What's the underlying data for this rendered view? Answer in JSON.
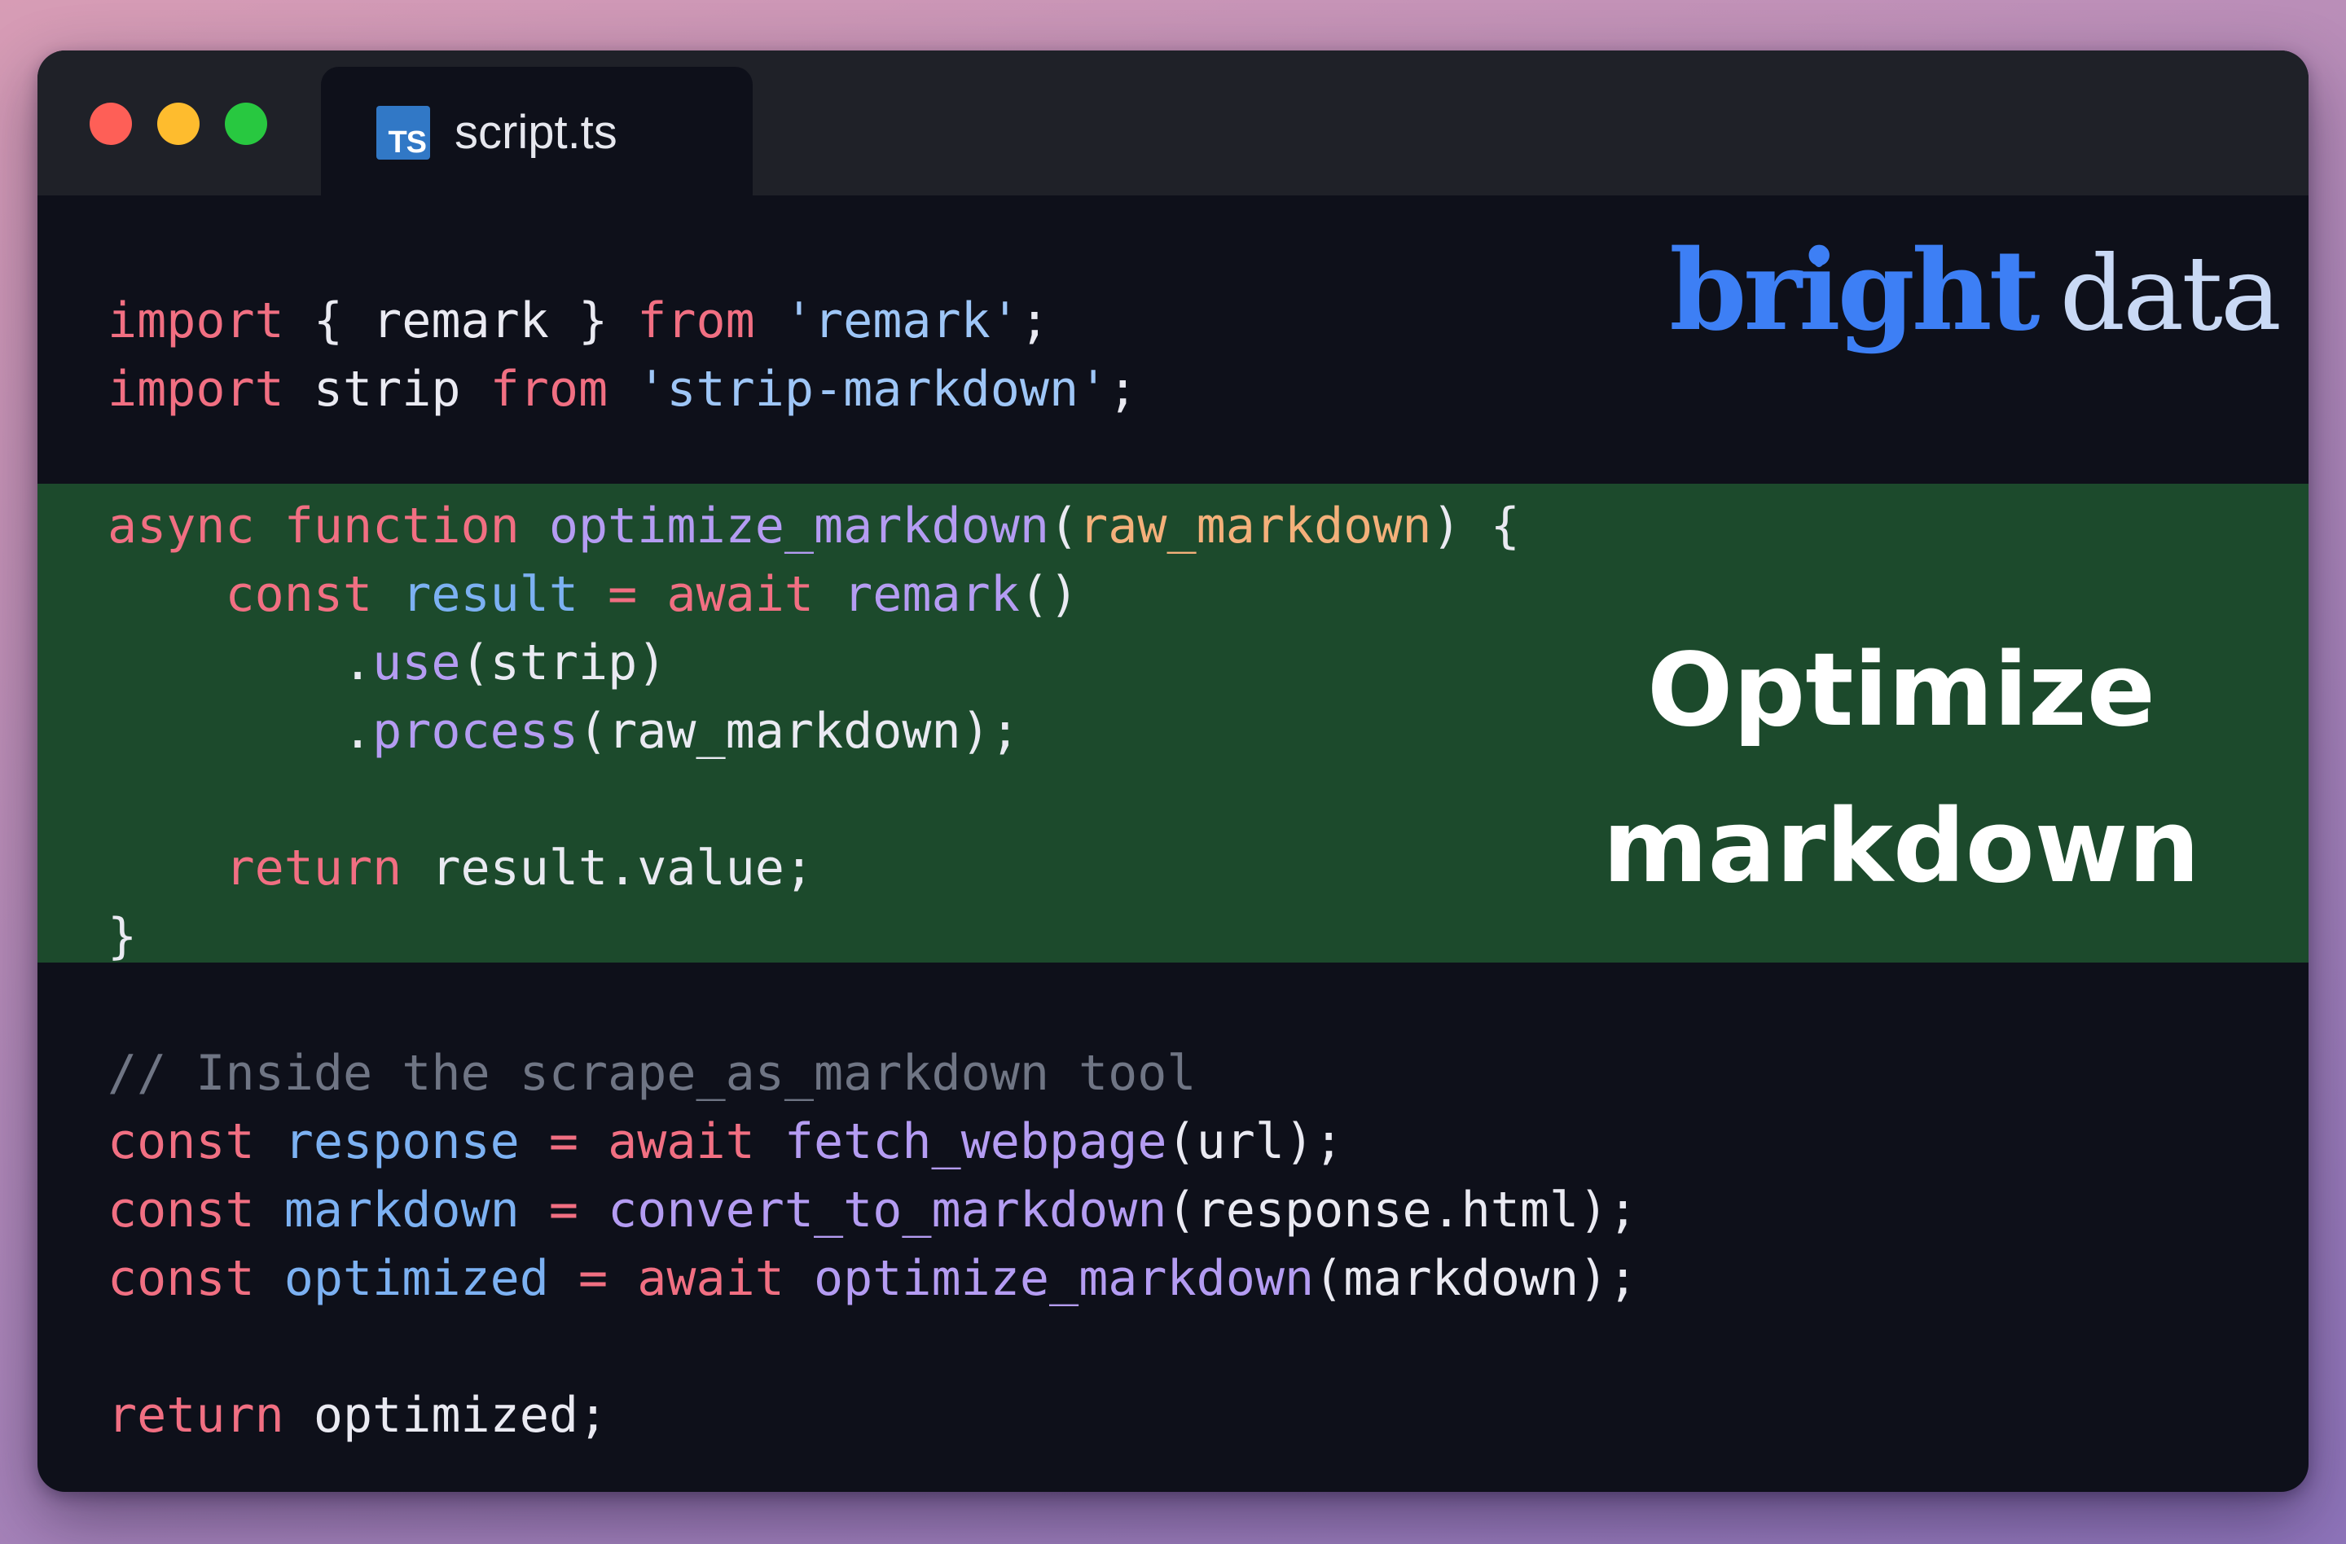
{
  "window": {
    "tab": {
      "icon_label": "TS",
      "filename": "script.ts"
    }
  },
  "brand": {
    "word1": "bright",
    "word2": "data"
  },
  "callout": {
    "line1": "Optimize",
    "line2": "markdown"
  },
  "code_lines": [
    [
      [
        "keyword",
        "import"
      ],
      [
        "plain",
        " { remark } "
      ],
      [
        "keyword",
        "from"
      ],
      [
        "plain",
        " "
      ],
      [
        "string",
        "'remark'"
      ],
      [
        "plain",
        ";"
      ]
    ],
    [
      [
        "keyword",
        "import"
      ],
      [
        "plain",
        " strip "
      ],
      [
        "keyword",
        "from"
      ],
      [
        "plain",
        " "
      ],
      [
        "string",
        "'strip-markdown'"
      ],
      [
        "plain",
        ";"
      ]
    ],
    [],
    [
      [
        "keyword",
        "async"
      ],
      [
        "plain",
        " "
      ],
      [
        "keyword",
        "function"
      ],
      [
        "plain",
        " "
      ],
      [
        "function",
        "optimize_markdown"
      ],
      [
        "plain",
        "("
      ],
      [
        "param",
        "raw_markdown"
      ],
      [
        "plain",
        ") {"
      ]
    ],
    [
      [
        "plain",
        "    "
      ],
      [
        "keyword",
        "const"
      ],
      [
        "plain",
        " "
      ],
      [
        "variable",
        "result"
      ],
      [
        "plain",
        " "
      ],
      [
        "keyword",
        "="
      ],
      [
        "plain",
        " "
      ],
      [
        "keyword",
        "await"
      ],
      [
        "plain",
        " "
      ],
      [
        "function",
        "remark"
      ],
      [
        "plain",
        "()"
      ]
    ],
    [
      [
        "plain",
        "        ."
      ],
      [
        "function",
        "use"
      ],
      [
        "plain",
        "(strip)"
      ]
    ],
    [
      [
        "plain",
        "        ."
      ],
      [
        "function",
        "process"
      ],
      [
        "plain",
        "(raw_markdown);"
      ]
    ],
    [],
    [
      [
        "plain",
        "    "
      ],
      [
        "keyword",
        "return"
      ],
      [
        "plain",
        " result.value;"
      ]
    ],
    [
      [
        "plain",
        "}"
      ]
    ],
    [],
    [
      [
        "comment",
        "// Inside the scrape_as_markdown tool"
      ]
    ],
    [
      [
        "keyword",
        "const"
      ],
      [
        "plain",
        " "
      ],
      [
        "variable",
        "response"
      ],
      [
        "plain",
        " "
      ],
      [
        "keyword",
        "="
      ],
      [
        "plain",
        " "
      ],
      [
        "keyword",
        "await"
      ],
      [
        "plain",
        " "
      ],
      [
        "function",
        "fetch_webpage"
      ],
      [
        "plain",
        "(url);"
      ]
    ],
    [
      [
        "keyword",
        "const"
      ],
      [
        "plain",
        " "
      ],
      [
        "variable",
        "markdown"
      ],
      [
        "plain",
        " "
      ],
      [
        "keyword",
        "="
      ],
      [
        "plain",
        " "
      ],
      [
        "function",
        "convert_to_markdown"
      ],
      [
        "plain",
        "(response.html);"
      ]
    ],
    [
      [
        "keyword",
        "const"
      ],
      [
        "plain",
        " "
      ],
      [
        "variable",
        "optimized"
      ],
      [
        "plain",
        " "
      ],
      [
        "keyword",
        "="
      ],
      [
        "plain",
        " "
      ],
      [
        "keyword",
        "await"
      ],
      [
        "plain",
        " "
      ],
      [
        "function",
        "optimize_markdown"
      ],
      [
        "plain",
        "(markdown);"
      ]
    ],
    [],
    [
      [
        "keyword",
        "return"
      ],
      [
        "plain",
        " optimized;"
      ]
    ]
  ],
  "highlighted_lines": [
    3,
    4,
    5,
    6,
    7,
    8,
    9
  ],
  "colors": {
    "keyword": "#f16f82",
    "string": "#9ec6f7",
    "function": "#b49cf2",
    "parameter": "#f4b07a",
    "variable": "#7cb1f2",
    "comment": "#6f7584",
    "highlight_background": "#1c4a2c",
    "editor_background": "#0e101a",
    "brand_blue": "#3d7ff5"
  }
}
